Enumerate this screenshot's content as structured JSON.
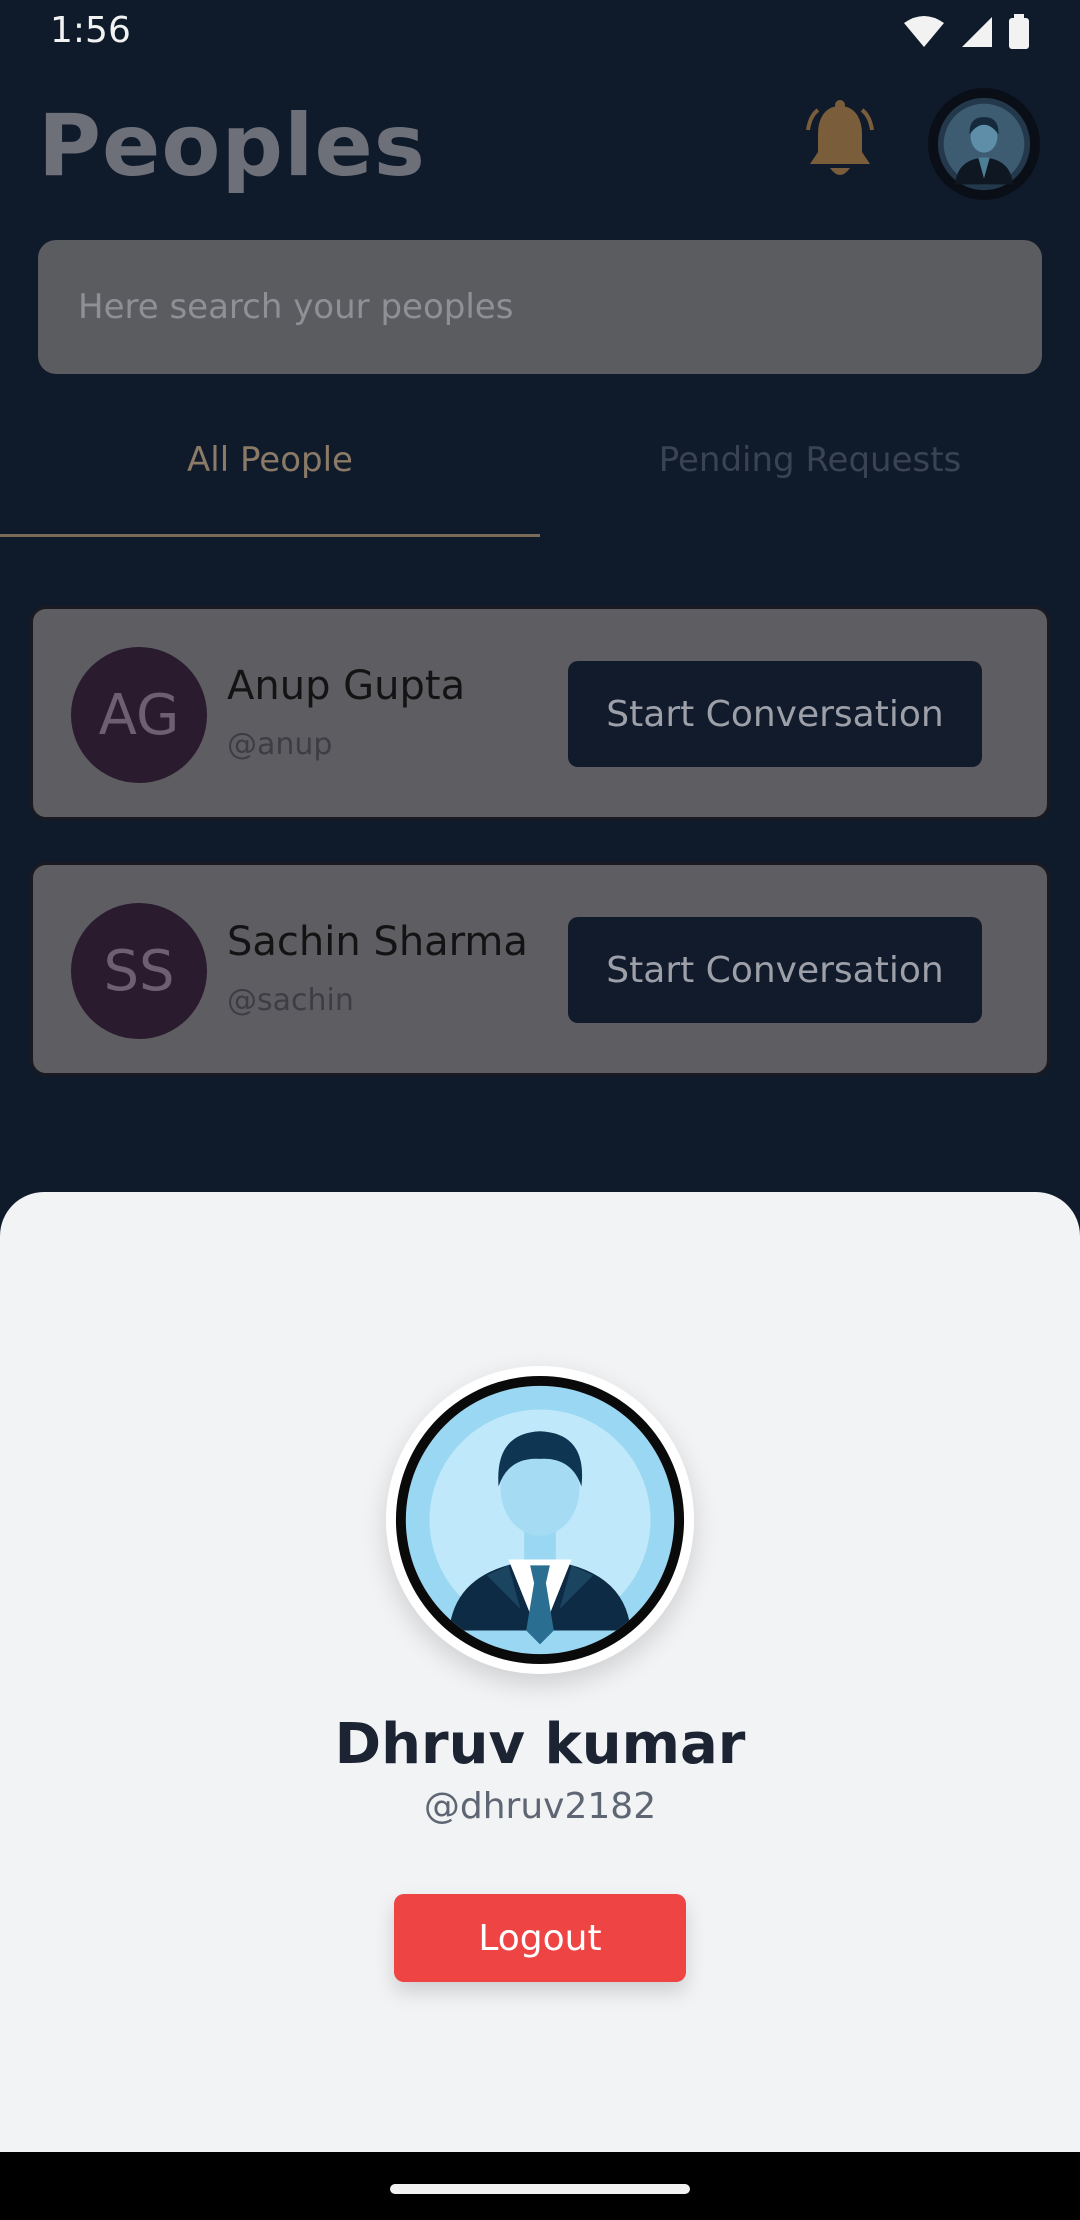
{
  "status_bar": {
    "time": "1:56"
  },
  "header": {
    "title": "Peoples"
  },
  "search": {
    "placeholder": "Here search your peoples"
  },
  "tabs": [
    {
      "label": "All People",
      "active": true
    },
    {
      "label": "Pending Requests",
      "active": false
    }
  ],
  "people": [
    {
      "initials": "AG",
      "name": "Anup Gupta",
      "handle": "@anup",
      "action": "Start Conversation"
    },
    {
      "initials": "SS",
      "name": "Sachin Sharma",
      "handle": "@sachin",
      "action": "Start Conversation"
    }
  ],
  "profile_sheet": {
    "name": "Dhruv kumar",
    "handle": "@dhruv2182",
    "logout_label": "Logout"
  },
  "colors": {
    "background": "#0f1a2b",
    "logout": "#ef4444",
    "sheet": "#f2f3f5",
    "avatar_circle": "#2a1b2f"
  },
  "icons": [
    "wifi-icon",
    "signal-icon",
    "battery-icon",
    "bell-icon",
    "user-avatar-icon"
  ]
}
